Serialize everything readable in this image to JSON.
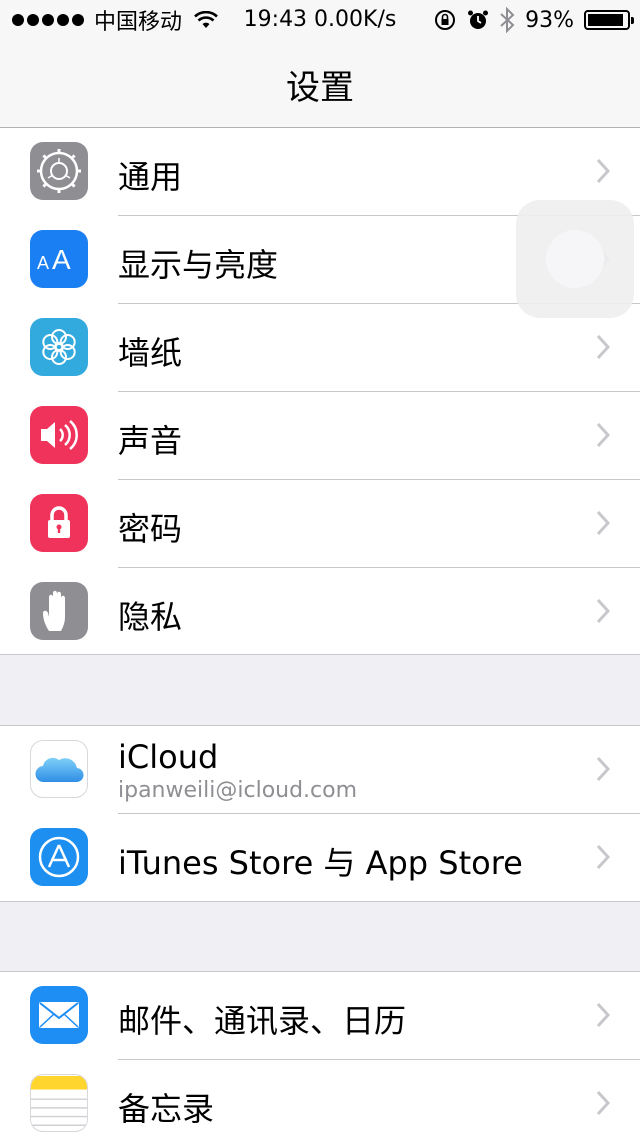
{
  "status_bar": {
    "carrier": "中国移动",
    "time_speed": "19:43 0.00K/s",
    "battery_percent": "93%",
    "battery_level": 0.93
  },
  "nav": {
    "title": "设置"
  },
  "group1": [
    {
      "label": "通用",
      "icon": "gear-icon",
      "color": "#8e8e93"
    },
    {
      "label": "显示与亮度",
      "icon": "text-size-icon",
      "color": "#1a7ff2"
    },
    {
      "label": "墙纸",
      "icon": "flower-icon",
      "color": "#33aadd"
    },
    {
      "label": "声音",
      "icon": "speaker-icon",
      "color": "#f0335a"
    },
    {
      "label": "密码",
      "icon": "lock-icon",
      "color": "#f0335a"
    },
    {
      "label": "隐私",
      "icon": "hand-icon",
      "color": "#8e8e93"
    }
  ],
  "group2": [
    {
      "label": "iCloud",
      "sublabel": "ipanweili@icloud.com",
      "icon": "cloud-icon",
      "color": "#ffffff"
    },
    {
      "label": "iTunes Store 与 App Store",
      "icon": "app-store-icon",
      "color": "#1d8ff0"
    }
  ],
  "group3": [
    {
      "label": "邮件、通讯录、日历",
      "icon": "mail-icon",
      "color": "#1e8ef5"
    },
    {
      "label": "备忘录",
      "icon": "notes-icon",
      "color": "#ffd52e"
    }
  ]
}
